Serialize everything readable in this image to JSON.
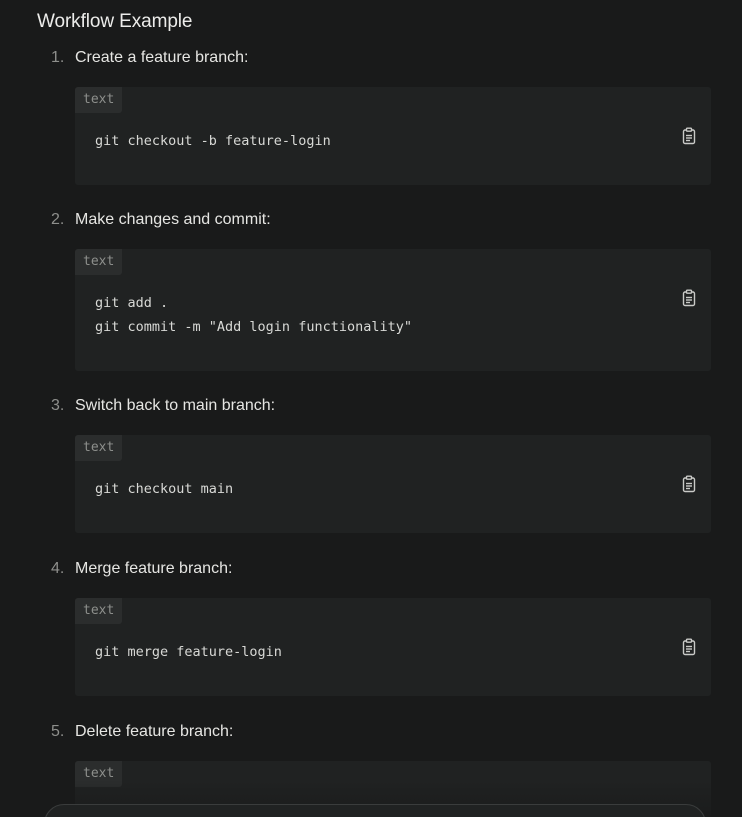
{
  "heading": "Workflow Example",
  "steps": [
    {
      "number": "1.",
      "label": "Create a feature branch:",
      "lang": "text",
      "code": "git checkout -b feature-login"
    },
    {
      "number": "2.",
      "label": "Make changes and commit:",
      "lang": "text",
      "code": "git add .\ngit commit -m \"Add login functionality\""
    },
    {
      "number": "3.",
      "label": "Switch back to main branch:",
      "lang": "text",
      "code": "git checkout main"
    },
    {
      "number": "4.",
      "label": "Merge feature branch:",
      "lang": "text",
      "code": "git merge feature-login"
    },
    {
      "number": "5.",
      "label": "Delete feature branch:",
      "lang": "text",
      "code": ""
    }
  ],
  "icons": {
    "copy": "clipboard-icon"
  },
  "colors": {
    "background": "#191a1a",
    "code_background": "#202222",
    "tag_background": "#2b2d2d",
    "muted_text": "#8e8f8c"
  }
}
